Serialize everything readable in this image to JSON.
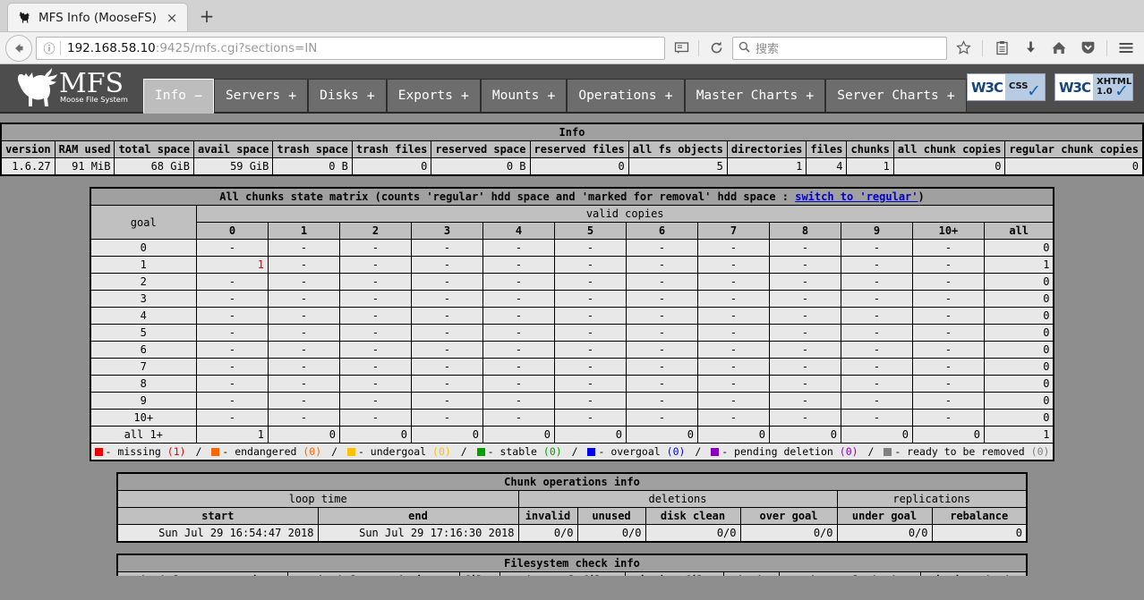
{
  "browser": {
    "tab_title": "MFS Info (MooseFS)",
    "tab_favicon": "moose-icon",
    "close_label": "×",
    "newtab_label": "+",
    "back_label": "←",
    "url_host": "192.168.58.10",
    "url_rest": ":9425/mfs.cgi?sections=IN",
    "search_placeholder": "搜索",
    "reader_icon": "reader-view-icon",
    "reload_icon": "reload-icon",
    "bookmark_icon": "star-icon",
    "library_icon": "library-icon",
    "download_icon": "download-icon",
    "home_icon": "home-icon",
    "pocket_icon": "pocket-icon",
    "menu_icon": "hamburger-menu-icon"
  },
  "mfs": {
    "logo_title": "MFS",
    "logo_subtitle": "Moose File System",
    "tabs": [
      {
        "label": "Info",
        "sign": "−",
        "active": true
      },
      {
        "label": "Servers",
        "sign": "+",
        "active": false
      },
      {
        "label": "Disks",
        "sign": "+",
        "active": false
      },
      {
        "label": "Exports",
        "sign": "+",
        "active": false
      },
      {
        "label": "Mounts",
        "sign": "+",
        "active": false
      },
      {
        "label": "Operations",
        "sign": "+",
        "active": false
      },
      {
        "label": "Master Charts",
        "sign": "+",
        "active": false
      },
      {
        "label": "Server Charts",
        "sign": "+",
        "active": false
      }
    ],
    "badges": [
      {
        "left": "W3C",
        "line1": "CSS",
        "line2": "",
        "name": "w3c-css-badge"
      },
      {
        "left": "W3C",
        "line1": "XHTML",
        "line2": "1.0",
        "name": "w3c-xhtml-badge"
      }
    ]
  },
  "info_table": {
    "title": "Info",
    "headers": [
      "version",
      "RAM used",
      "total space",
      "avail space",
      "trash space",
      "trash files",
      "reserved space",
      "reserved files",
      "all fs objects",
      "directories",
      "files",
      "chunks",
      "all chunk copies",
      "regular chunk copies"
    ],
    "values": [
      "1.6.27",
      "91 MiB",
      "68 GiB",
      "59 GiB",
      "0 B",
      "0",
      "0 B",
      "0",
      "5",
      "1",
      "4",
      "1",
      "0",
      "0"
    ]
  },
  "chunks_matrix": {
    "title_pre": "All chunks state matrix (counts 'regular' hdd space and 'marked for removal' hdd space : ",
    "title_link": "switch to 'regular'",
    "title_post": ")",
    "goal_label": "goal",
    "valid_copies_label": "valid copies",
    "columns": [
      "0",
      "1",
      "2",
      "3",
      "4",
      "5",
      "6",
      "7",
      "8",
      "9",
      "10+",
      "all"
    ],
    "rows": [
      {
        "goal": "0",
        "cells": [
          "-",
          "-",
          "-",
          "-",
          "-",
          "-",
          "-",
          "-",
          "-",
          "-",
          "-"
        ],
        "all": "0"
      },
      {
        "goal": "1",
        "cells": [
          "1",
          "-",
          "-",
          "-",
          "-",
          "-",
          "-",
          "-",
          "-",
          "-",
          "-"
        ],
        "all": "1",
        "highlight": {
          "index": 0,
          "color": "#e00000"
        }
      },
      {
        "goal": "2",
        "cells": [
          "-",
          "-",
          "-",
          "-",
          "-",
          "-",
          "-",
          "-",
          "-",
          "-",
          "-"
        ],
        "all": "0"
      },
      {
        "goal": "3",
        "cells": [
          "-",
          "-",
          "-",
          "-",
          "-",
          "-",
          "-",
          "-",
          "-",
          "-",
          "-"
        ],
        "all": "0"
      },
      {
        "goal": "4",
        "cells": [
          "-",
          "-",
          "-",
          "-",
          "-",
          "-",
          "-",
          "-",
          "-",
          "-",
          "-"
        ],
        "all": "0"
      },
      {
        "goal": "5",
        "cells": [
          "-",
          "-",
          "-",
          "-",
          "-",
          "-",
          "-",
          "-",
          "-",
          "-",
          "-"
        ],
        "all": "0"
      },
      {
        "goal": "6",
        "cells": [
          "-",
          "-",
          "-",
          "-",
          "-",
          "-",
          "-",
          "-",
          "-",
          "-",
          "-"
        ],
        "all": "0"
      },
      {
        "goal": "7",
        "cells": [
          "-",
          "-",
          "-",
          "-",
          "-",
          "-",
          "-",
          "-",
          "-",
          "-",
          "-"
        ],
        "all": "0"
      },
      {
        "goal": "8",
        "cells": [
          "-",
          "-",
          "-",
          "-",
          "-",
          "-",
          "-",
          "-",
          "-",
          "-",
          "-"
        ],
        "all": "0"
      },
      {
        "goal": "9",
        "cells": [
          "-",
          "-",
          "-",
          "-",
          "-",
          "-",
          "-",
          "-",
          "-",
          "-",
          "-"
        ],
        "all": "0"
      },
      {
        "goal": "10+",
        "cells": [
          "-",
          "-",
          "-",
          "-",
          "-",
          "-",
          "-",
          "-",
          "-",
          "-",
          "-"
        ],
        "all": "0"
      },
      {
        "goal": "all 1+",
        "cells": [
          "1",
          "0",
          "0",
          "0",
          "0",
          "0",
          "0",
          "0",
          "0",
          "0",
          "0"
        ],
        "all": "1"
      }
    ],
    "legend": [
      {
        "color": "#ee0000",
        "label": "missing",
        "count": "(1)",
        "count_color": "#ee0000"
      },
      {
        "color": "#ff6600",
        "label": "endangered",
        "count": "(0)",
        "count_color": "#ff6600"
      },
      {
        "color": "#ffc000",
        "label": "undergoal",
        "count": "(0)",
        "count_color": "#ffc000"
      },
      {
        "color": "#00a000",
        "label": "stable",
        "count": "(0)",
        "count_color": "#00a000"
      },
      {
        "color": "#0000ee",
        "label": "overgoal",
        "count": "(0)",
        "count_color": "#0000ee"
      },
      {
        "color": "#8800bb",
        "label": "pending deletion",
        "count": "(0)",
        "count_color": "#8800bb"
      },
      {
        "color": "#808080",
        "label": "ready to be removed",
        "count": "(0)",
        "count_color": "#808080"
      }
    ],
    "legend_dash": "-",
    "legend_sep": "/"
  },
  "chunk_ops": {
    "title": "Chunk operations info",
    "groups": [
      {
        "label": "loop time",
        "span": 2
      },
      {
        "label": "deletions",
        "span": 4
      },
      {
        "label": "replications",
        "span": 2
      }
    ],
    "headers": [
      "start",
      "end",
      "invalid",
      "unused",
      "disk clean",
      "over goal",
      "under goal",
      "rebalance"
    ],
    "values": [
      "Sun Jul 29 16:54:47 2018",
      "Sun Jul 29 17:16:30 2018",
      "0/0",
      "0/0",
      "0/0",
      "0/0",
      "0/0",
      "0"
    ]
  },
  "fs_check": {
    "title": "Filesystem check info",
    "headers": [
      "check loop start time",
      "check loop end time",
      "files",
      "under-goal files",
      "missing files",
      "chunks",
      "under-goal chunks",
      "missing chunks"
    ]
  },
  "colors": {
    "page_background": "#8e8e8e",
    "header_background": "#4d4d4d",
    "tab_background": "#6d6d6d",
    "active_tab_background": "#bdbdbd",
    "table_title_background": "#a0a0a0",
    "table_header_background": "#c0c0c0",
    "table_cell_background": "#e8e8e8",
    "link": "#0000cc"
  }
}
